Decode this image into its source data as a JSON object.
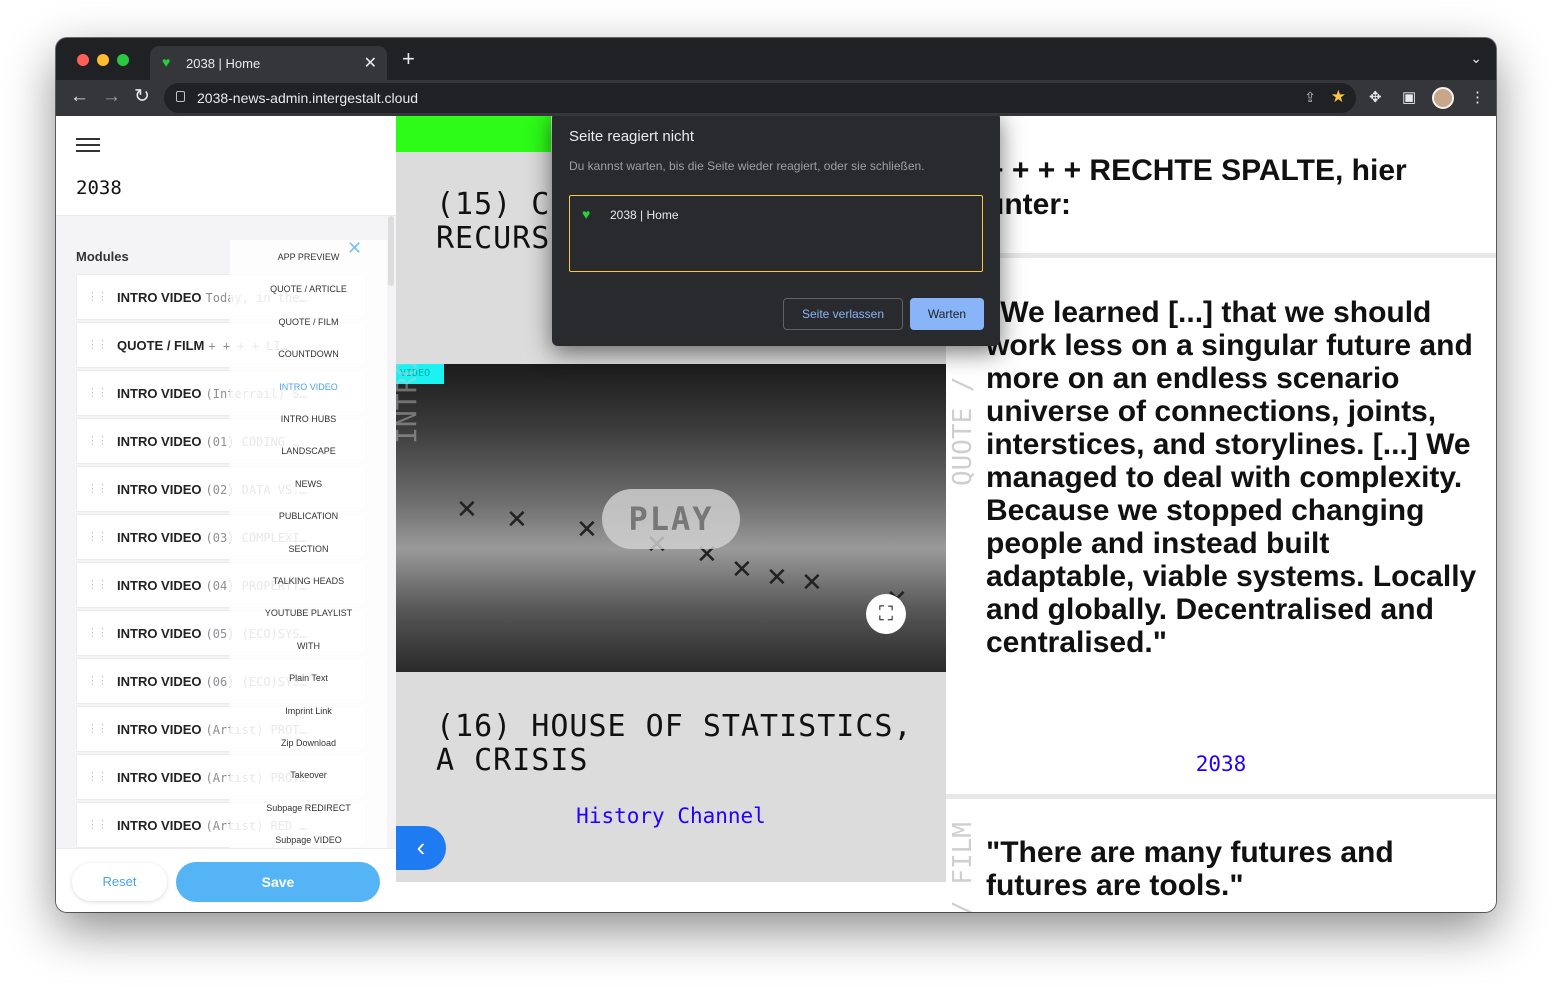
{
  "browser": {
    "tab_title": "2038 | Home",
    "tab_favicon": "green-heart-icon",
    "new_tab": "+",
    "url": "2038-news-admin.intergestalt.cloud"
  },
  "sidebar": {
    "title": "2038",
    "modules_heading": "Modules",
    "modules": [
      {
        "type": "INTRO VIDEO",
        "sub": "Today, in the…"
      },
      {
        "type": "QUOTE / FILM",
        "sub": "+ + + + LI…"
      },
      {
        "type": "INTRO VIDEO",
        "sub": "(Interrail) S…"
      },
      {
        "type": "INTRO VIDEO",
        "sub": "(01) CODING …"
      },
      {
        "type": "INTRO VIDEO",
        "sub": "(02) DATA VS.…"
      },
      {
        "type": "INTRO VIDEO",
        "sub": "(03) COMPLEXI…"
      },
      {
        "type": "INTRO VIDEO",
        "sub": "(04) PROPERTY…"
      },
      {
        "type": "INTRO VIDEO",
        "sub": "(05) (ECO)SYS…"
      },
      {
        "type": "INTRO VIDEO",
        "sub": "(06) (ECO)SYS…"
      },
      {
        "type": "INTRO VIDEO",
        "sub": "(Artist) PROT…"
      },
      {
        "type": "INTRO VIDEO",
        "sub": "(Artist) PROT…"
      },
      {
        "type": "INTRO VIDEO",
        "sub": "(Artist) RED …"
      }
    ],
    "dropdown": [
      "APP PREVIEW",
      "QUOTE / ARTICLE",
      "QUOTE / FILM",
      "COUNTDOWN",
      "INTRO VIDEO",
      "INTRO HUBS",
      "LANDSCAPE",
      "NEWS",
      "PUBLICATION",
      "SECTION",
      "TALKING HEADS",
      "YOUTUBE PLAYLIST",
      "WITH",
      "Plain Text",
      "Imprint Link",
      "Zip Download",
      "Takeover",
      "Subpage REDIRECT",
      "Subpage VIDEO"
    ],
    "dropdown_active": "INTRO VIDEO",
    "reset_label": "Reset",
    "save_label": "Save"
  },
  "middle": {
    "title_top": "(15) C\nRECURS",
    "video_label": "VIDEO",
    "video_side": "INTRO VIDEO",
    "play_label": "PLAY",
    "title_bottom": "(16) HOUSE OF STATISTICS, A CRISIS",
    "channel": "History Channel"
  },
  "right": {
    "top_text": "+ + + + RECHTE SPALTE, hier unter:",
    "quote": "\"We learned [...] that we should work less on a singular future and more on an endless scenario universe of connections, joints, interstices, and storylines. [...] We managed to deal with complexity. Because we stopped changing people and instead built adaptable, viable systems. Locally and globally. Decentralised and centralised.\"",
    "quote_source": "2038",
    "quote_side": "QUOTE /",
    "quote2": "\"There are many futures and futures are tools.\"",
    "quote2_side": "/ FILM"
  },
  "dialog": {
    "title": "Seite reagiert nicht",
    "message": "Du kannst warten, bis die Seite wieder reagiert, oder sie schließen.",
    "page_title": "2038 | Home",
    "leave_label": "Seite verlassen",
    "wait_label": "Warten"
  },
  "colors": {
    "accent_blue": "#55b4f5",
    "link_blue": "#2200ff",
    "green_bar": "#2dfb18",
    "dialog_highlight": "#f9c740"
  }
}
